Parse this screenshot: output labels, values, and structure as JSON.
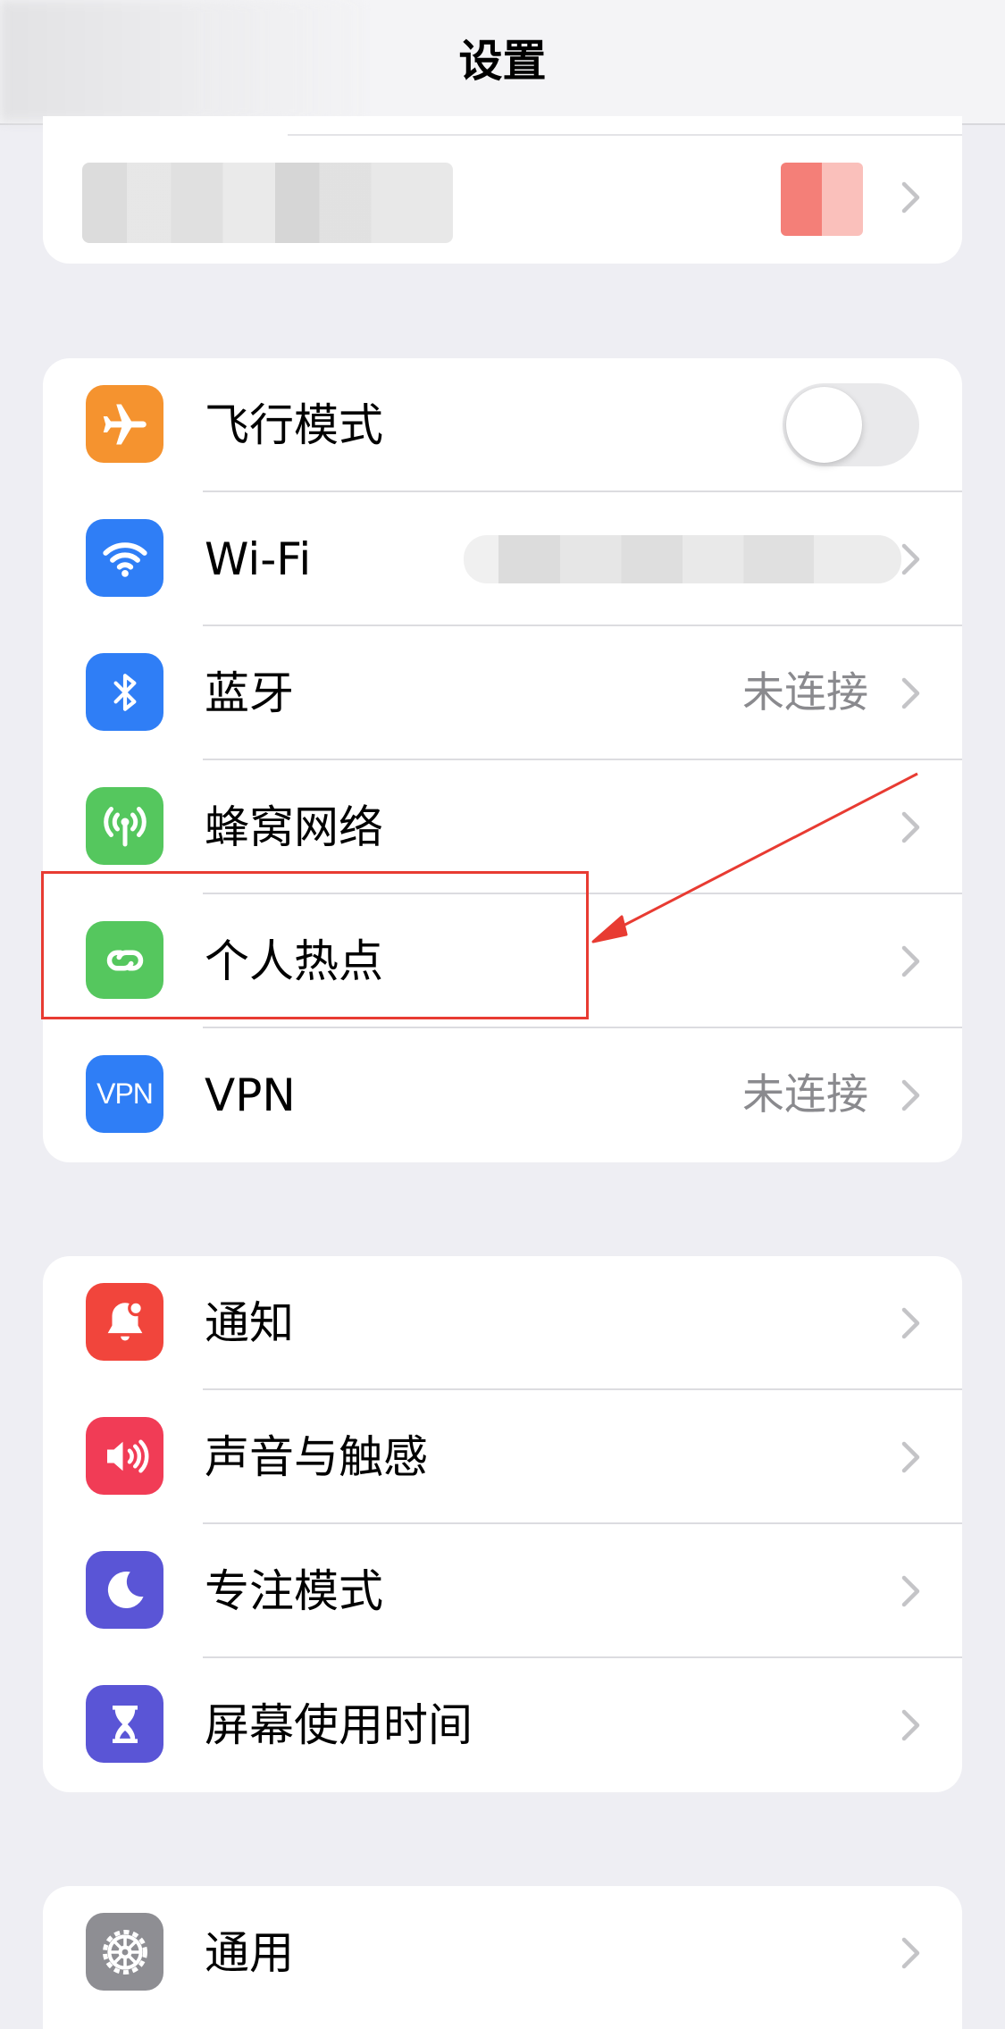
{
  "nav": {
    "title": "设置"
  },
  "colors": {
    "background": "#eeeef3",
    "airplane": "#f5932f",
    "wifi": "#2f7ef6",
    "bluetooth": "#2f7ef6",
    "cellular": "#55c75e",
    "hotspot": "#55c75e",
    "vpn": "#2f7ef6",
    "notifications": "#f1453c",
    "sounds": "#f13c56",
    "focus": "#5a55d6",
    "screen_time": "#5a55d6",
    "general": "#8e8e93",
    "annotation": "#e83b32"
  },
  "group1": [
    {
      "icon": "airplane-icon",
      "label": "飞行模式",
      "toggle_on": false
    },
    {
      "icon": "wifi-icon",
      "label": "Wi-Fi",
      "value": ""
    },
    {
      "icon": "bluetooth-icon",
      "label": "蓝牙",
      "value": "未连接"
    },
    {
      "icon": "cellular-icon",
      "label": "蜂窝网络",
      "value": ""
    },
    {
      "icon": "hotspot-icon",
      "label": "个人热点",
      "value": ""
    },
    {
      "icon": "vpn-icon",
      "label": "VPN",
      "value": "未连接",
      "icon_text": "VPN"
    }
  ],
  "group2": [
    {
      "icon": "notifications-icon",
      "label": "通知"
    },
    {
      "icon": "sounds-icon",
      "label": "声音与触感"
    },
    {
      "icon": "focus-icon",
      "label": "专注模式"
    },
    {
      "icon": "screen-time-icon",
      "label": "屏幕使用时间"
    }
  ],
  "group3": [
    {
      "icon": "gear-icon",
      "label": "通用"
    }
  ]
}
